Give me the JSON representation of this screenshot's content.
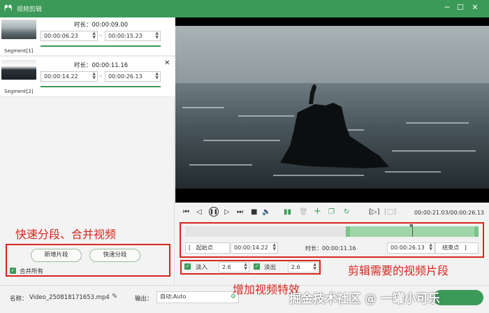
{
  "titlebar": {
    "title": "视频剪辑",
    "logo": "ᖰᖳ",
    "min": "─",
    "max": "☐",
    "close": "✕"
  },
  "segments": [
    {
      "label": "Segment[1]",
      "duration": "时长：00:00:09.00",
      "start": "00:00:06.23",
      "end": "00:00:15.23"
    },
    {
      "label": "Segment[2]",
      "duration": "时长：00:00:11.16",
      "start": "00:00:14.22",
      "end": "00:00:26.13"
    }
  ],
  "left_buttons": {
    "add_segment": "新增片段",
    "quick_split": "快速分段",
    "merge_all": "合并所有"
  },
  "annotations": {
    "left": "快速分段、合并视频",
    "right": "剪辑需要的视频片段",
    "bottom": "增加视频特效"
  },
  "player": {
    "time": "00:00:21.03/00:00:26.13"
  },
  "trim": {
    "start_label": "起始点",
    "start_value": "00:00:14.22",
    "duration": "时长：00:00:11.16",
    "end_value": "00:00:26.13",
    "end_label": "结束点"
  },
  "effects": {
    "fade_in_label": "淡入",
    "fade_in_value": "2.6",
    "fade_out_label": "淡出",
    "fade_out_value": "2.6"
  },
  "bottom": {
    "name_label": "名称：",
    "name_value": "Video_250818171653.mp4",
    "output_label": "输出：",
    "output_value": "自动;Auto"
  },
  "watermark": "掘金技术社区 @ 一罐小可乐",
  "colors": {
    "accent": "#3c9a58",
    "annotation": "#d8261e"
  }
}
